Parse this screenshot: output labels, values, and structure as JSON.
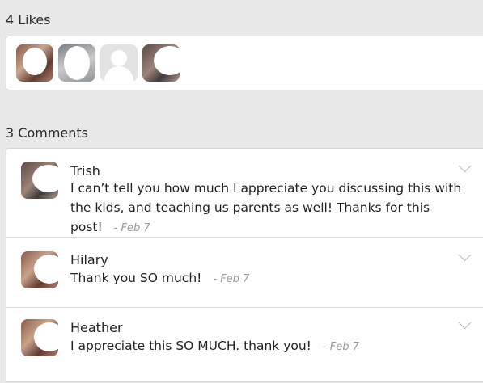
{
  "likes": {
    "title": "4 Likes",
    "avatars": [
      {
        "icon": "user-photo-avatar"
      },
      {
        "icon": "user-photo-avatar"
      },
      {
        "icon": "default-user-avatar"
      },
      {
        "icon": "user-photo-avatar"
      }
    ]
  },
  "comments": {
    "title": "3 Comments",
    "items": [
      {
        "name": "Trish",
        "text": "I can’t tell you how much I appreciate you discussing this with the kids, and teaching us parents as well! Thanks for this post!",
        "date": "- Feb 7"
      },
      {
        "name": "Hilary",
        "text": "Thank you SO much!",
        "date": "- Feb 7"
      },
      {
        "name": "Heather",
        "text": "I appreciate this SO MUCH. thank you!",
        "date": "- Feb 7"
      }
    ]
  },
  "colors": {
    "background": "#e8e8e8",
    "card": "#ffffff",
    "muted_text": "#9a9a9a"
  }
}
